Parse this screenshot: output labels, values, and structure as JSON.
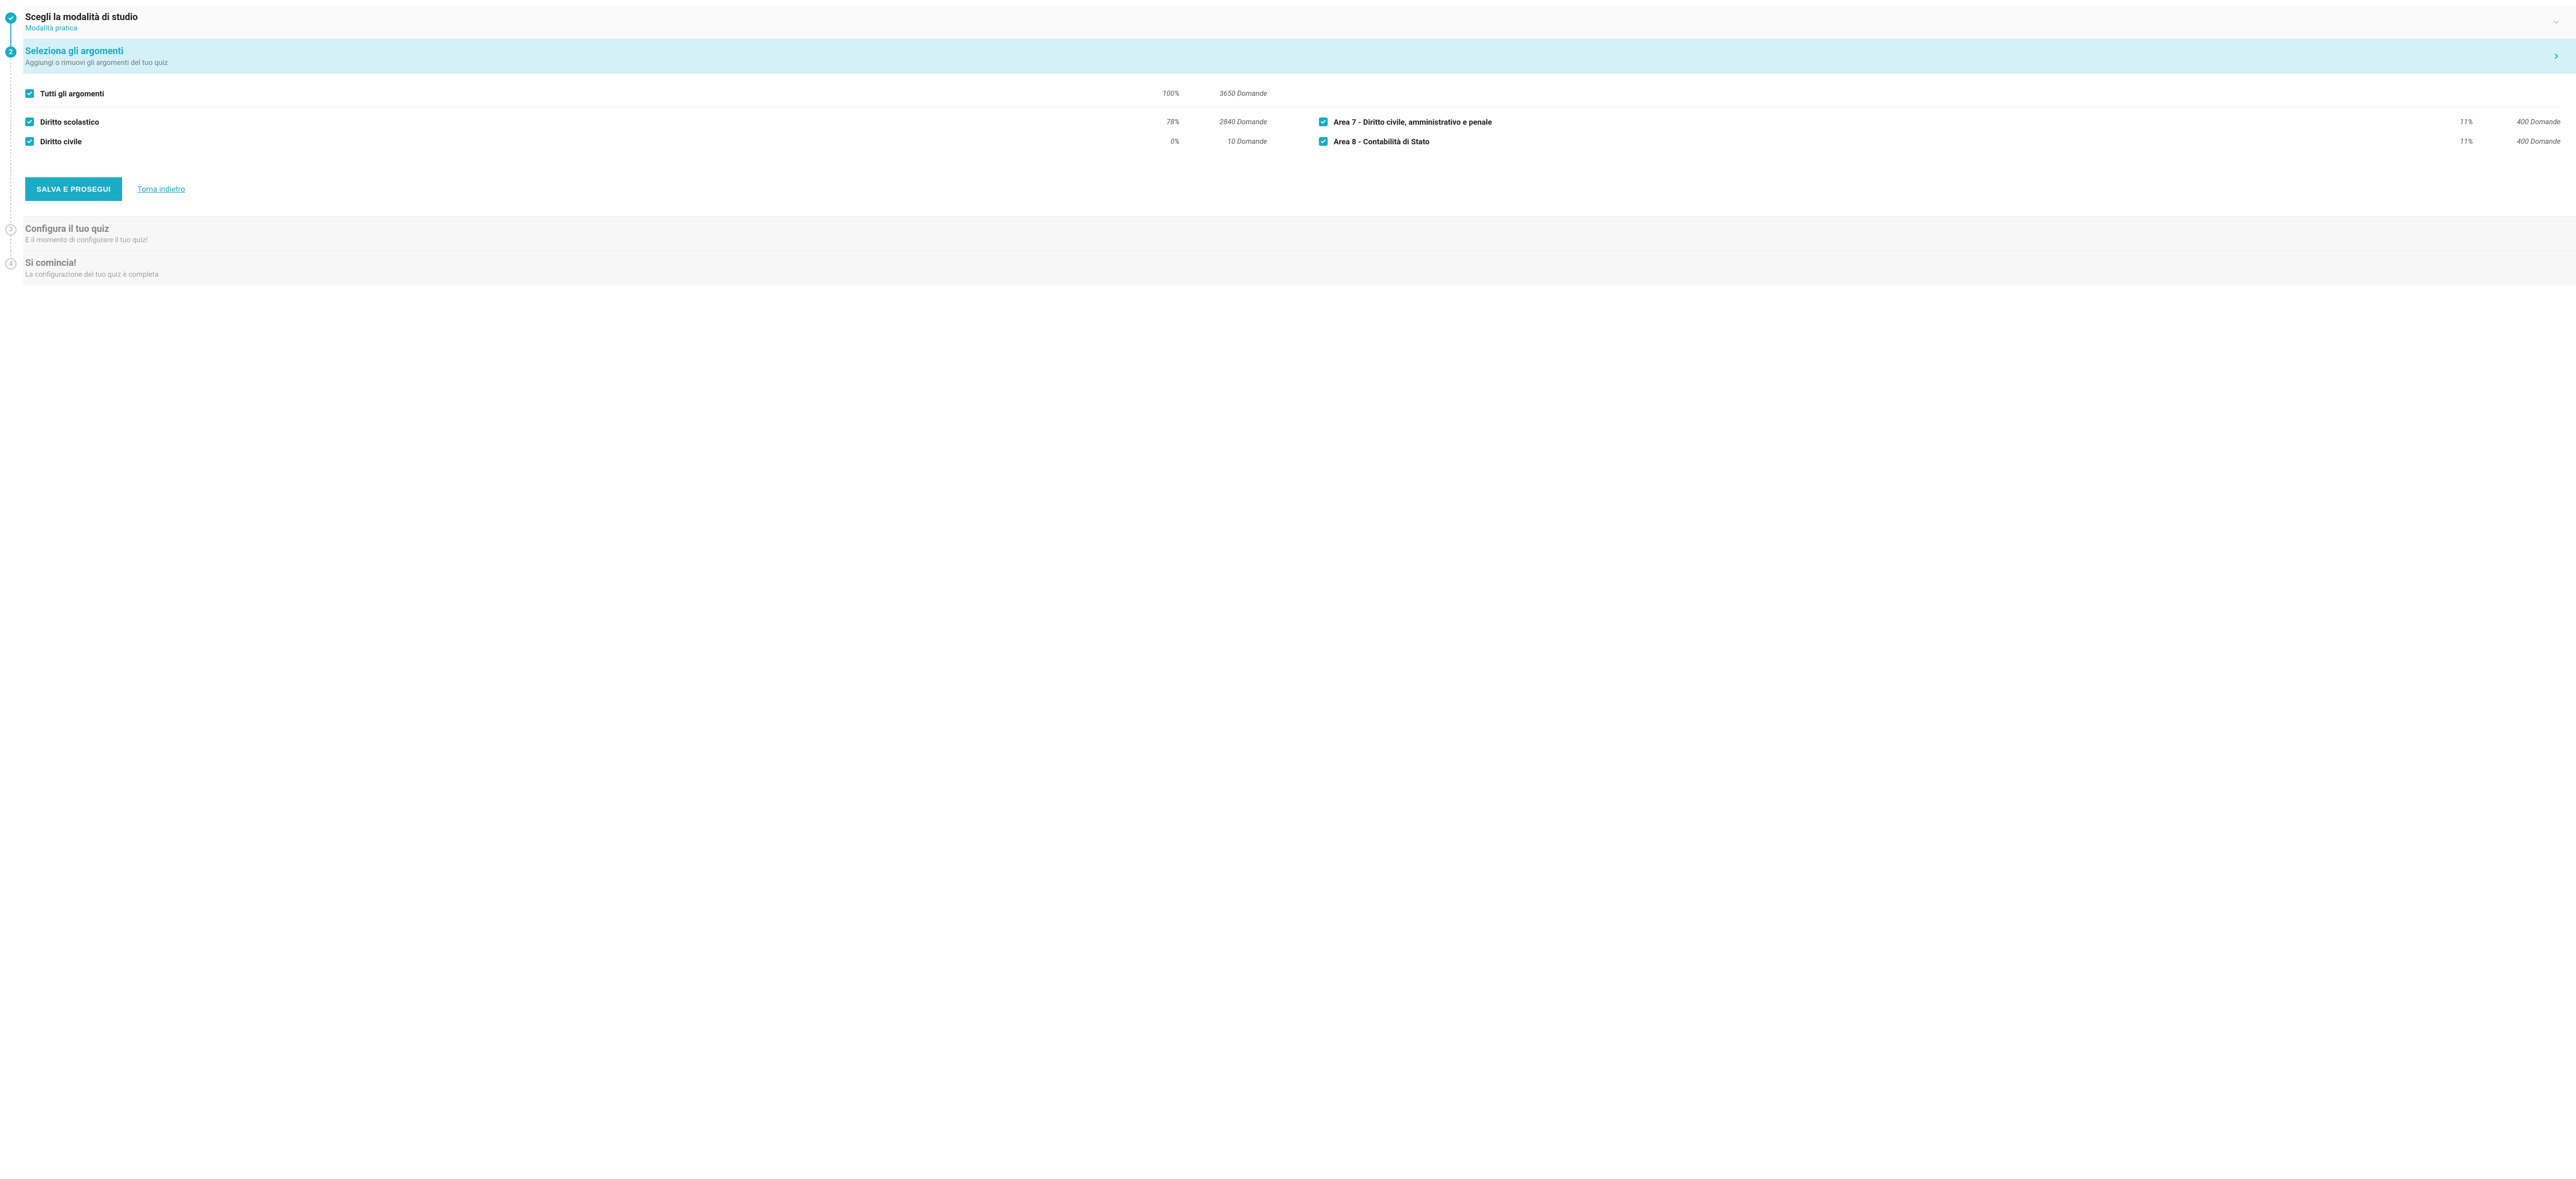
{
  "steps": {
    "s1": {
      "title": "Scegli la modalità di studio",
      "subtitle": "Modalità pratica"
    },
    "s2": {
      "number": "2",
      "title": "Seleziona gli argomenti",
      "subtitle": "Aggiungi o rimuovi gli argomenti del tuo quiz"
    },
    "s3": {
      "number": "3",
      "title": "Configura il tuo quiz",
      "subtitle": "E il momento di configurare il tuo quiz!"
    },
    "s4": {
      "number": "4",
      "title": "Si comincia!",
      "subtitle": "La configurazione del tuo quiz è completa"
    }
  },
  "topics": {
    "all": {
      "label": "Tutti gli argomenti",
      "pct": "100%",
      "count": "3650 Domande"
    },
    "left": [
      {
        "label": "Diritto scolastico",
        "pct": "78%",
        "count": "2840 Domande"
      },
      {
        "label": "Diritto civile",
        "pct": "0%",
        "count": "10 Domande"
      }
    ],
    "right": [
      {
        "label": "Area 7 - Diritto civile, amministrativo e penale",
        "pct": "11%",
        "count": "400 Domande"
      },
      {
        "label": "Area 8 - Contabilità di Stato",
        "pct": "11%",
        "count": "400 Domande"
      }
    ]
  },
  "actions": {
    "primary": "SALVA E PROSEGUI",
    "back": "Torna indietro"
  }
}
